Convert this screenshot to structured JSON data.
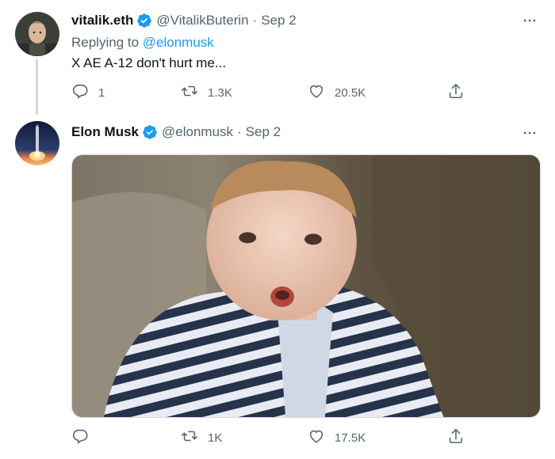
{
  "tweets": [
    {
      "author": {
        "name": "vitalik.eth",
        "handle": "@VitalikButerin",
        "verified": true
      },
      "separator": "·",
      "date": "Sep 2",
      "replying_prefix": "Replying to ",
      "replying_to": "@elonmusk",
      "text": "X AE A-12 don't hurt me...",
      "stats": {
        "replies": "1",
        "retweets": "1.3K",
        "likes": "20.5K"
      }
    },
    {
      "author": {
        "name": "Elon Musk",
        "handle": "@elonmusk",
        "verified": true
      },
      "separator": "·",
      "date": "Sep 2",
      "media": {
        "type": "image",
        "description": "toddler in striped shirt"
      },
      "stats": {
        "replies": "",
        "retweets": "1K",
        "likes": "17.5K"
      }
    }
  ],
  "colors": {
    "accent": "#1d9bf0",
    "secondary_text": "#536471",
    "primary_text": "#0f1419",
    "thread_line": "#cfd9de"
  },
  "icons": [
    "verified-badge-icon",
    "more-icon",
    "reply-icon",
    "retweet-icon",
    "like-icon",
    "share-icon"
  ]
}
